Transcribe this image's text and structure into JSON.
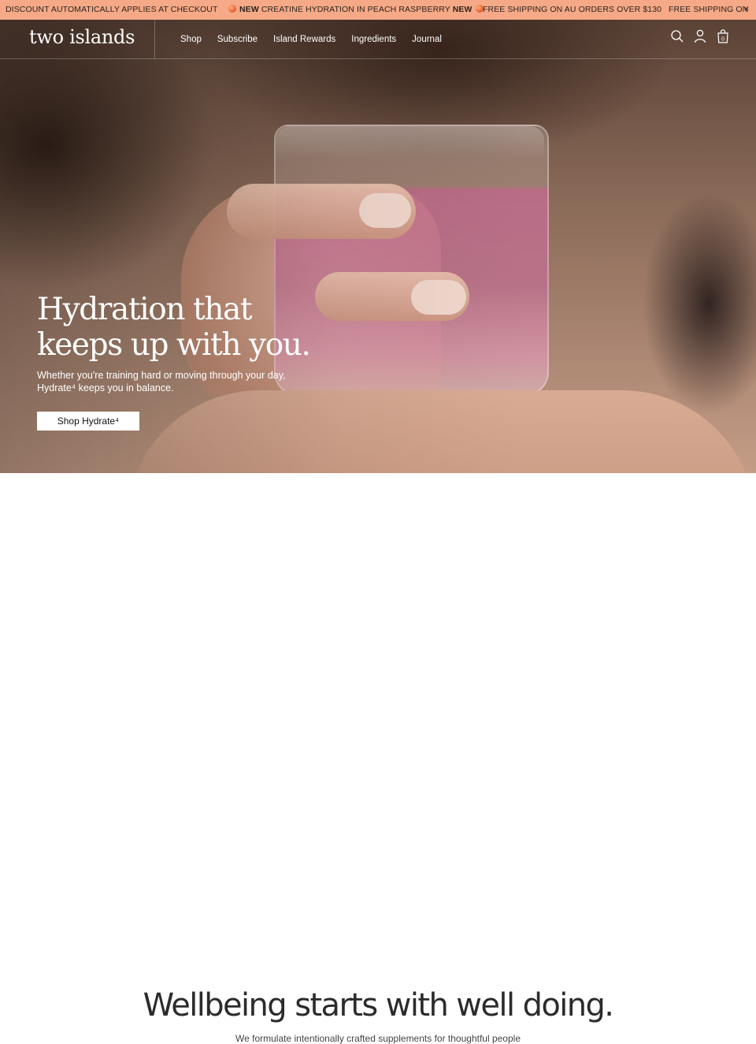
{
  "announcement": {
    "messages": [
      "DISCOUNT AUTOMATICALLY APPLIES AT CHECKOUT",
      "NEW",
      "CREATINE HYDRATION IN PEACH RASPBERRY",
      "NEW",
      "FREE SHIPPING ON AU ORDERS OVER $130",
      "FREE SHIPPING ON"
    ],
    "close_label": "×",
    "bg_color": "#f6a986"
  },
  "header": {
    "logo": "two islands",
    "nav": [
      "Shop",
      "Subscribe",
      "Island Rewards",
      "Ingredients",
      "Journal"
    ],
    "icons": [
      "search-icon",
      "account-icon",
      "cart-icon"
    ],
    "cart_count": "0"
  },
  "hero": {
    "title_line1": "Hydration that",
    "title_line2": "keeps up with you.",
    "subtitle_line1": "Whether you're training hard or moving through your day,",
    "subtitle_line2": "Hydrate⁴ keeps you in balance.",
    "button_label": "Shop Hydrate⁴"
  },
  "intro": {
    "heading": "Wellbeing starts with well doing.",
    "subtext": "We formulate intentionally crafted supplements for thoughtful people"
  }
}
